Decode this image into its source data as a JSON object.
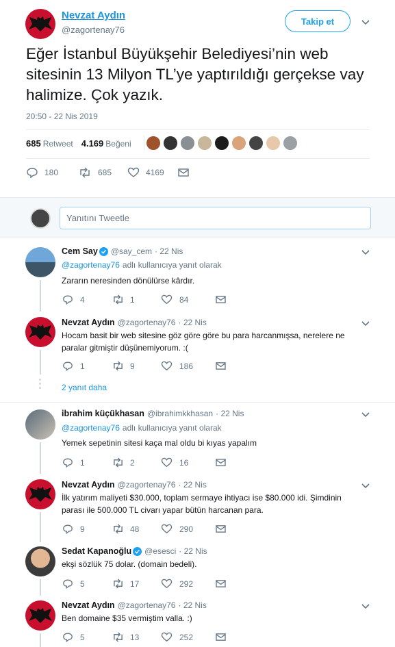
{
  "main_tweet": {
    "author_name": "Nevzat Aydın",
    "author_handle": "@zagortenay76",
    "follow_label": "Takip et",
    "text": "Eğer İstanbul Büyükşehir Belediyesi’nin web sitesinin 13 Milyon TL’ye yaptırıldığı gerçekse vay halimize. Çok yazık.",
    "timestamp": "20:50 - 22 Nis 2019",
    "retweet_count": "685",
    "retweet_label": "Retweet",
    "like_count": "4.169",
    "like_label": "Beğeni",
    "actions": {
      "replies": "180",
      "retweets": "685",
      "likes": "4169"
    }
  },
  "reply_box": {
    "placeholder": "Yanıtını Tweetle"
  },
  "replies": [
    {
      "name": "Cem Say",
      "verified": true,
      "handle": "@say_cem",
      "date": "· 22 Nis",
      "reply_to_handle": "@zagortenay76",
      "reply_to_suffix": "adlı kullanıcıya yanıt olarak",
      "text": "Zararın neresinden dönülürse kârdır.",
      "replies": "4",
      "retweets": "1",
      "likes": "84"
    },
    {
      "name": "Nevzat Aydın",
      "handle": "@zagortenay76",
      "date": "· 22 Nis",
      "text": "Hocam basit bir web sitesine göz göre göre bu para harcanmışsa, nerelere ne paralar gitmiştir düşünemiyorum. :(",
      "replies": "1",
      "retweets": "9",
      "likes": "186"
    },
    {
      "more_label": "2 yanıt daha"
    },
    {
      "name": "ibrahim küçükhasan",
      "handle": "@ibrahimkkhasan",
      "date": "· 22 Nis",
      "reply_to_handle": "@zagortenay76",
      "reply_to_suffix": "adlı kullanıcıya yanıt olarak",
      "text": "Yemek sepetinin sitesi kaça mal oldu bi kıyas yapalım",
      "replies": "1",
      "retweets": "2",
      "likes": "16"
    },
    {
      "name": "Nevzat Aydın",
      "handle": "@zagortenay76",
      "date": "· 22 Nis",
      "text": "İlk yatırım maliyeti $30.000, toplam sermaye ihtiyacı ise $80.000 idi. Şimdinin parası ile 500.000 TL civarı yapar bütün harcanan para.",
      "replies": "9",
      "retweets": "48",
      "likes": "290"
    },
    {
      "name": "Sedat Kapanoğlu",
      "verified": true,
      "handle": "@esesci",
      "date": "· 22 Nis",
      "text": "ekşi sözlük 75 dolar. (domain bedeli).",
      "replies": "5",
      "retweets": "17",
      "likes": "292"
    },
    {
      "name": "Nevzat Aydın",
      "handle": "@zagortenay76",
      "date": "· 22 Nis",
      "text": "Ben domaine $35 vermiştim valla. :)",
      "replies": "5",
      "retweets": "13",
      "likes": "252"
    }
  ],
  "colors": {
    "accent": "#1da1f2",
    "link": "#1b95e0",
    "muted": "#657786",
    "logo_red": "#c8102e"
  }
}
